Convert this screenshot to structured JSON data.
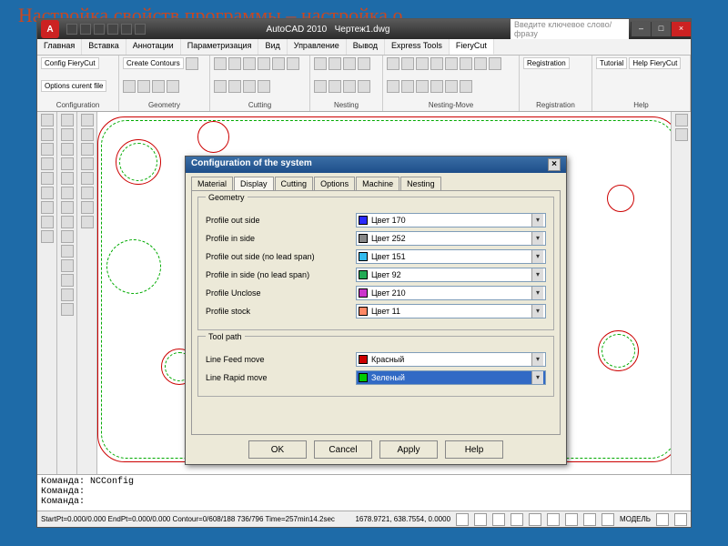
{
  "slide_title": "Настройка свойств программы – настройка о",
  "title": {
    "app": "AutoCAD 2010",
    "file": "Чертеж1.dwg"
  },
  "search_placeholder": "Введите ключевое слово/фразу",
  "ribbon": {
    "tabs": [
      "Главная",
      "Вставка",
      "Аннотации",
      "Параметризация",
      "Вид",
      "Управление",
      "Вывод",
      "Express Tools",
      "FieryCut"
    ],
    "active_tab": 8,
    "groups": [
      {
        "label": "Configuration",
        "items": [
          "Config FieryCut",
          "Options curent file"
        ]
      },
      {
        "label": "Geometry",
        "items": [
          "Create Contours"
        ]
      },
      {
        "label": "Cutting",
        "items": []
      },
      {
        "label": "Nesting",
        "items": []
      },
      {
        "label": "Nesting-Move",
        "items": []
      },
      {
        "label": "Registration",
        "items": [
          "Registration"
        ]
      },
      {
        "label": "Help",
        "items": [
          "Tutorial",
          "Help FieryCut"
        ]
      }
    ]
  },
  "dialog": {
    "title": "Configuration of the system",
    "tabs": [
      "Material",
      "Display",
      "Cutting",
      "Options",
      "Machine",
      "Nesting"
    ],
    "active_tab": 1,
    "groups": [
      {
        "legend": "Geometry",
        "rows": [
          {
            "label": "Profile out side",
            "value": "Цвет 170",
            "swatch": "#2a2aff"
          },
          {
            "label": "Profile in side",
            "value": "Цвет 252",
            "swatch": "#888888"
          },
          {
            "label": "Profile out side (no lead span)",
            "value": "Цвет 151",
            "swatch": "#33bbee"
          },
          {
            "label": "Profile in side (no lead span)",
            "value": "Цвет 92",
            "swatch": "#22aa55"
          },
          {
            "label": "Profile Unclose",
            "value": "Цвет 210",
            "swatch": "#cc33cc"
          },
          {
            "label": "Profile stock",
            "value": "Цвет 11",
            "swatch": "#ff8866"
          }
        ]
      },
      {
        "legend": "Tool path",
        "rows": [
          {
            "label": "Line Feed move",
            "value": "Красный",
            "swatch": "#cc0000"
          },
          {
            "label": "Line Rapid move",
            "value": "Зеленый",
            "swatch": "#00cc00",
            "selected": true
          }
        ]
      }
    ],
    "buttons": [
      "OK",
      "Cancel",
      "Apply",
      "Help"
    ]
  },
  "cmd": {
    "l1": "Команда: NCConfig",
    "l2": "Команда:",
    "l3": "Команда:"
  },
  "status": {
    "left": "StartPt=0.000/0.000   EndPt=0.000/0.000   Contour=0/608/188   736/796  Time=257min14.2sec",
    "coords": "1678.9721, 638.7554, 0.0000",
    "model": "МОДЕЛЬ"
  }
}
